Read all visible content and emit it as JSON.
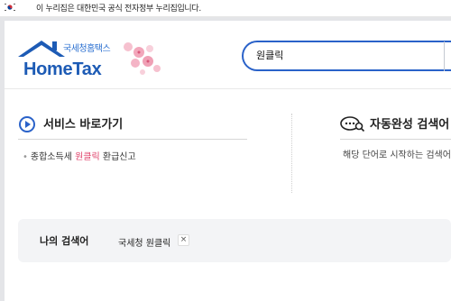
{
  "gov_banner": {
    "text": "이 누리집은 대한민국 공식 전자정부 누리집입니다."
  },
  "logo": {
    "subtitle": "국세청홈택스",
    "wordmark": "HomeTax"
  },
  "search": {
    "value": "원클릭"
  },
  "services": {
    "title": "서비스 바로가기",
    "items": [
      {
        "prefix": "종합소득세",
        "highlight": "원클릭",
        "suffix": "환급신고"
      }
    ]
  },
  "autocomplete": {
    "title": "자동완성 검색어",
    "description": "해당 단어로 시작하는 검색어"
  },
  "my_search": {
    "label": "나의 검색어",
    "tags": [
      {
        "text": "국세청 원클릭",
        "remove": "×"
      }
    ]
  },
  "colors": {
    "brand_blue": "#1d5bb5",
    "search_border": "#2a62c9",
    "highlight": "#e0446c"
  }
}
